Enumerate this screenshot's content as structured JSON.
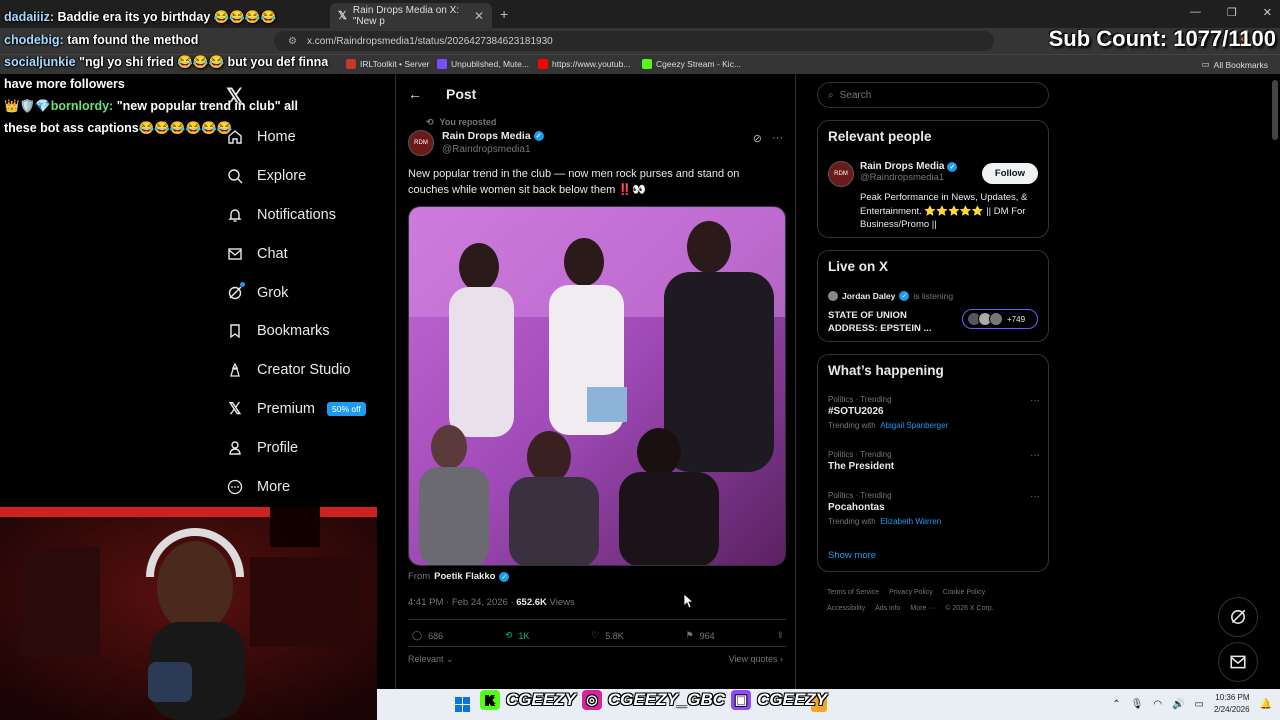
{
  "browser": {
    "tab_title": "Rain Drops Media on X: \"New p",
    "url": "x.com/Raindropsmedia1/status/2026427384623181930",
    "bookmarks": [
      "IRLToolkit • Server",
      "Unpublished, Mute...",
      "https://www.youtub...",
      "Cgeezy Stream - Kic..."
    ],
    "all_bookmarks": "All Bookmarks"
  },
  "overlay": {
    "sub_count": "Sub Count: 1077/1100",
    "chat": [
      {
        "user": "dadaiiiz:",
        "text": "Baddie era its yo birthday 😂😂😂😂"
      },
      {
        "user": "chodebig:",
        "text": "tam found the method"
      },
      {
        "user": "socialjunkie",
        "text": "\"ngl yo shi fried 😂😂😂 but you def finna have more followers"
      },
      {
        "user": "bornlordy:",
        "text": "\"new popular trend in club\" all these bot ass captions😂😂😂😂😂😂"
      }
    ],
    "social_handle": "CGEEZY",
    "social_handle_2": "CGEEZY_GBC",
    "social_handle_3": "CGEEZY"
  },
  "nav": {
    "items": [
      {
        "label": "Home",
        "icon": "home-icon"
      },
      {
        "label": "Explore",
        "icon": "search-icon"
      },
      {
        "label": "Notifications",
        "icon": "bell-icon"
      },
      {
        "label": "Chat",
        "icon": "mail-icon"
      },
      {
        "label": "Grok",
        "icon": "grok-icon"
      },
      {
        "label": "Bookmarks",
        "icon": "bookmark-icon"
      },
      {
        "label": "Creator Studio",
        "icon": "creator-icon"
      },
      {
        "label": "Premium",
        "icon": "x-icon"
      },
      {
        "label": "Profile",
        "icon": "person-icon"
      },
      {
        "label": "More",
        "icon": "more-icon"
      }
    ],
    "premium_badge": "50% off"
  },
  "post": {
    "header": "Post",
    "reposted": "You reposted",
    "author_name": "Rain Drops Media",
    "author_handle": "@Raindropsmedia1",
    "text": "New popular trend in the club — now men rock purses and stand on couches while women sit back below them ‼️👀",
    "from_label": "From",
    "from_name": "Poetik Flakko",
    "time": "4:41 PM · Feb 24, 2026 · ",
    "views_count": "652.6K",
    "views_label": " Views",
    "stats": {
      "replies": "686",
      "reposts": "1K",
      "likes": "5.8K",
      "bookmarks": "964"
    },
    "relevant": "Relevant",
    "view_quotes": "View quotes"
  },
  "sidebar": {
    "search_placeholder": "Search",
    "relevant_title": "Relevant people",
    "rp_name": "Rain Drops Media",
    "rp_handle": "@Raindropsmedia1",
    "follow": "Follow",
    "rp_bio": "Peak Performance in News, Updates, & Entertainment. ⭐⭐⭐⭐⭐ || DM For Business/Promo ||",
    "live_title": "Live on X",
    "live_host": "Jordan Daley",
    "live_status": "is listening",
    "live_space": "STATE OF UNION ADDRESS: EPSTEIN ...",
    "live_count": "+749",
    "happening_title": "What’s happening",
    "trends": [
      {
        "meta": "Politics · Trending",
        "name": "#SOTU2026",
        "with_label": "Trending with",
        "with": "Abigail Spanberger"
      },
      {
        "meta": "Politics · Trending",
        "name": "The President",
        "with_label": "",
        "with": ""
      },
      {
        "meta": "Politics · Trending",
        "name": "Pocahontas",
        "with_label": "Trending with",
        "with": "Elizabeth Warren"
      }
    ],
    "show_more": "Show more",
    "footer": [
      "Terms of Service",
      "Privacy Policy",
      "Cookie Policy",
      "Accessibility",
      "Ads info",
      "More ···",
      "© 2026 X Corp."
    ]
  },
  "taskbar": {
    "time": "10:36 PM",
    "date": "2/24/2026"
  }
}
